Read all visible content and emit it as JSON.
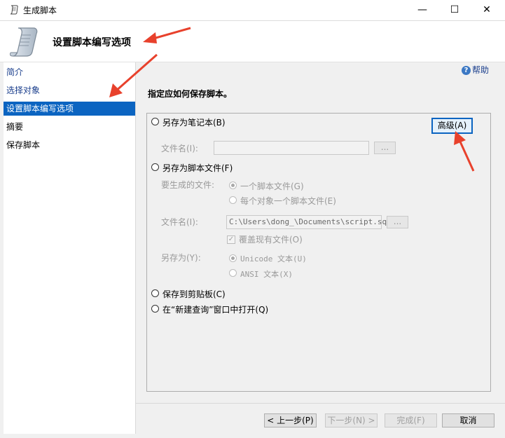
{
  "window": {
    "title": "生成脚本",
    "minimize": "—",
    "maximize": "☐",
    "close": "✕"
  },
  "header": {
    "title": "设置脚本编写选项"
  },
  "nav": {
    "items": [
      {
        "label": "简介"
      },
      {
        "label": "选择对象"
      },
      {
        "label": "设置脚本编写选项"
      },
      {
        "label": "摘要"
      },
      {
        "label": "保存脚本"
      }
    ]
  },
  "help": {
    "label": "帮助"
  },
  "main": {
    "instruction": "指定应如何保存脚本。",
    "advanced_button": "高级(A)",
    "save_notepad": {
      "label": "另存为笔记本(B)",
      "filename_label": "文件名(I):",
      "filename_value": "",
      "browse": "..."
    },
    "save_script_file": {
      "label": "另存为脚本文件(F)",
      "files_to_generate_label": "要生成的文件:",
      "option_single": "一个脚本文件(G)",
      "option_per_object": "每个对象一个脚本文件(E)",
      "filename_label": "文件名(I):",
      "filename_value": "C:\\Users\\dong_\\Documents\\script.sql",
      "browse": "...",
      "overwrite_label": "覆盖现有文件(O)",
      "save_as_label": "另存为(Y):",
      "unicode": "Unicode 文本(U)",
      "ansi": "ANSI 文本(X)"
    },
    "save_clipboard": {
      "label": "保存到剪贴板(C)"
    },
    "open_new_query": {
      "label": "在“新建查询”窗口中打开(Q)"
    }
  },
  "footer": {
    "back": "< 上一步(P)",
    "next": "下一步(N) >",
    "finish": "完成(F)",
    "cancel": "取消"
  },
  "annotation_color": "#e8412c"
}
